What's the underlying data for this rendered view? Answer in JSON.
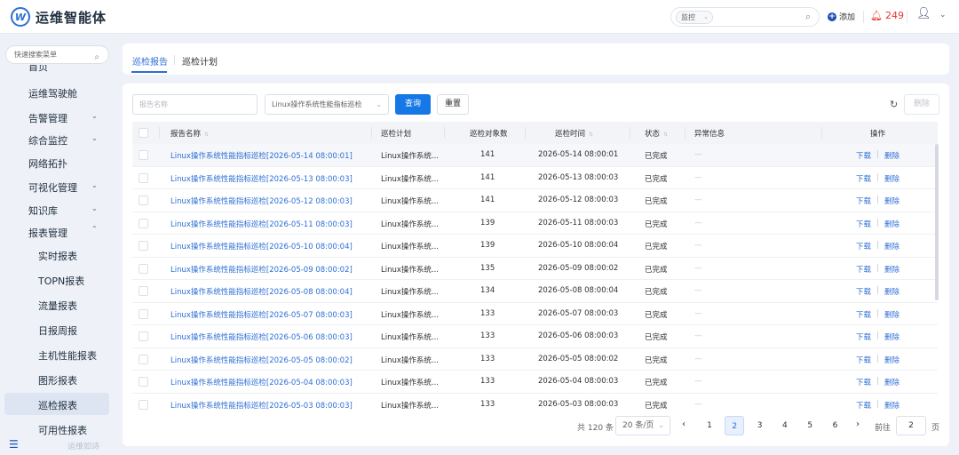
{
  "header": {
    "app_title": "运维智能体",
    "search_scope": "监控",
    "add_label": "添加",
    "alert_count": "249"
  },
  "sidebar": {
    "search_placeholder": "快速搜索菜单",
    "partial_item": "首页",
    "items": [
      "运维驾驶舱",
      "告警管理",
      "综合监控",
      "网络拓扑",
      "可视化管理",
      "知识库",
      "报表管理"
    ],
    "sub_items": [
      "实时报表",
      "TOPN报表",
      "流量报表",
      "日报周报",
      "主机性能报表",
      "图形报表",
      "巡检报表",
      "可用性报表"
    ],
    "watermark": "运维如诗"
  },
  "tabs": [
    "巡检报告",
    "巡检计划"
  ],
  "filters": {
    "name_placeholder": "报告名称",
    "plan_value": "Linux操作系统性能指标巡检",
    "query_label": "查询",
    "reset_label": "重置",
    "delete_label": "删除"
  },
  "table": {
    "columns": [
      "报告名称",
      "巡检计划",
      "巡检对象数",
      "巡检时间",
      "状态",
      "异常信息",
      "操作"
    ],
    "download_label": "下载",
    "delete_label": "删除",
    "rows": [
      {
        "name": "Linux操作系统性能指标巡检[2026-05-14 08:00:01]",
        "plan": "Linux操作系统...",
        "count": "141",
        "time": "2026-05-14 08:00:01",
        "status": "已完成",
        "error": "—"
      },
      {
        "name": "Linux操作系统性能指标巡检[2026-05-13 08:00:03]",
        "plan": "Linux操作系统...",
        "count": "141",
        "time": "2026-05-13 08:00:03",
        "status": "已完成",
        "error": "—"
      },
      {
        "name": "Linux操作系统性能指标巡检[2026-05-12 08:00:03]",
        "plan": "Linux操作系统...",
        "count": "141",
        "time": "2026-05-12 08:00:03",
        "status": "已完成",
        "error": "—"
      },
      {
        "name": "Linux操作系统性能指标巡检[2026-05-11 08:00:03]",
        "plan": "Linux操作系统...",
        "count": "139",
        "time": "2026-05-11 08:00:03",
        "status": "已完成",
        "error": "—"
      },
      {
        "name": "Linux操作系统性能指标巡检[2026-05-10 08:00:04]",
        "plan": "Linux操作系统...",
        "count": "139",
        "time": "2026-05-10 08:00:04",
        "status": "已完成",
        "error": "—"
      },
      {
        "name": "Linux操作系统性能指标巡检[2026-05-09 08:00:02]",
        "plan": "Linux操作系统...",
        "count": "135",
        "time": "2026-05-09 08:00:02",
        "status": "已完成",
        "error": "—"
      },
      {
        "name": "Linux操作系统性能指标巡检[2026-05-08 08:00:04]",
        "plan": "Linux操作系统...",
        "count": "134",
        "time": "2026-05-08 08:00:04",
        "status": "已完成",
        "error": "—"
      },
      {
        "name": "Linux操作系统性能指标巡检[2026-05-07 08:00:03]",
        "plan": "Linux操作系统...",
        "count": "133",
        "time": "2026-05-07 08:00:03",
        "status": "已完成",
        "error": "—"
      },
      {
        "name": "Linux操作系统性能指标巡检[2026-05-06 08:00:03]",
        "plan": "Linux操作系统...",
        "count": "133",
        "time": "2026-05-06 08:00:03",
        "status": "已完成",
        "error": "—"
      },
      {
        "name": "Linux操作系统性能指标巡检[2026-05-05 08:00:02]",
        "plan": "Linux操作系统...",
        "count": "133",
        "time": "2026-05-05 08:00:02",
        "status": "已完成",
        "error": "—"
      },
      {
        "name": "Linux操作系统性能指标巡检[2026-05-04 08:00:03]",
        "plan": "Linux操作系统...",
        "count": "133",
        "time": "2026-05-04 08:00:03",
        "status": "已完成",
        "error": "—"
      },
      {
        "name": "Linux操作系统性能指标巡检[2026-05-03 08:00:03]",
        "plan": "Linux操作系统...",
        "count": "133",
        "time": "2026-05-03 08:00:03",
        "status": "已完成",
        "error": "—"
      }
    ]
  },
  "pagination": {
    "total_label": "共 120 条",
    "page_size_label": "20 条/页",
    "pages": [
      "1",
      "2",
      "3",
      "4",
      "5",
      "6"
    ],
    "current_page": "2",
    "goto_label": "前往",
    "goto_value": "2",
    "page_suffix": "页"
  },
  "colors": {
    "primary": "#1677e6",
    "link": "#2d6fd6",
    "alert": "#e53935"
  }
}
